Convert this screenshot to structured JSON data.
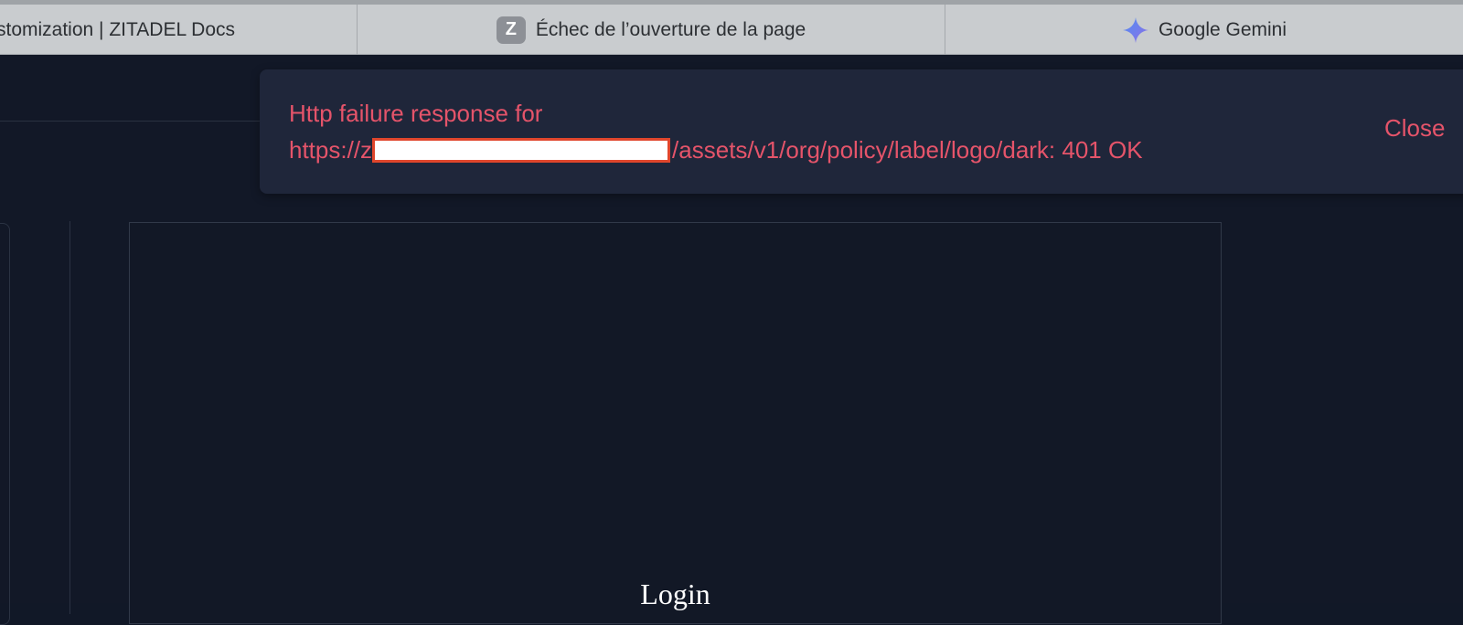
{
  "browser": {
    "tabs": [
      {
        "label": "stomization | ZITADEL Docs"
      },
      {
        "label": "Échec de l’ouverture de la page",
        "favicon_letter": "Z"
      },
      {
        "label": "Google Gemini"
      }
    ]
  },
  "preview": {
    "title": "Login"
  },
  "snackbar": {
    "line1": "Http failure response for",
    "url_prefix": "https://z",
    "url_suffix": "/assets/v1/org/policy/label/logo/dark: 401 OK",
    "close_label": "Close"
  },
  "colors": {
    "background": "#111827",
    "snackbar_bg": "#1f263a",
    "error_text": "#e5546a",
    "redaction_border": "#e0462c",
    "gemini_star": "#5b8def"
  },
  "icons": {
    "tab2_favicon": "zitadel-z-icon",
    "tab3_favicon": "gemini-sparkle-icon"
  }
}
